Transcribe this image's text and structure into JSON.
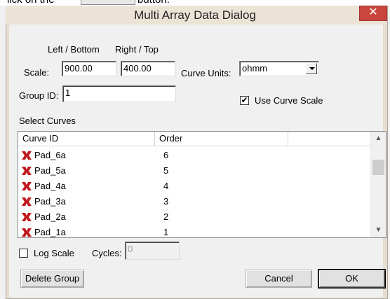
{
  "instruction": {
    "text_before": "lick on the",
    "text_after": "button."
  },
  "window": {
    "title": "Multi Array Data Dialog",
    "close_glyph": "✕"
  },
  "scale": {
    "label": "Scale:",
    "left_bottom_label": "Left / Bottom",
    "right_top_label": "Right / Top",
    "left_bottom_value": "900.00",
    "right_top_value": "400.00"
  },
  "curve_units": {
    "label": "Curve Units:",
    "value": "ohmm"
  },
  "group_id": {
    "label": "Group ID:",
    "value": "1"
  },
  "use_curve_scale": {
    "label": "Use Curve Scale",
    "checked": true,
    "check_glyph": "✔"
  },
  "select_curves": {
    "label": "Select Curves",
    "columns": [
      "Curve ID",
      "Order"
    ],
    "rows": [
      {
        "curve_id": "Pad_6a",
        "order": "6"
      },
      {
        "curve_id": "Pad_5a",
        "order": "5"
      },
      {
        "curve_id": "Pad_4a",
        "order": "4"
      },
      {
        "curve_id": "Pad_3a",
        "order": "3"
      },
      {
        "curve_id": "Pad_2a",
        "order": "2"
      },
      {
        "curve_id": "Pad_1a",
        "order": "1"
      }
    ],
    "row_icon": "red-curve-icon",
    "scroll_up_glyph": "▲",
    "scroll_down_glyph": "▼"
  },
  "log_scale": {
    "label": "Log Scale",
    "checked": false
  },
  "cycles": {
    "label": "Cycles:",
    "value": "0"
  },
  "buttons": {
    "delete_group": "Delete Group",
    "cancel": "Cancel",
    "ok": "OK"
  },
  "colors": {
    "icon_red": "#c0181d",
    "close_red": "#c9463d",
    "frame": "#e6dcd0"
  }
}
